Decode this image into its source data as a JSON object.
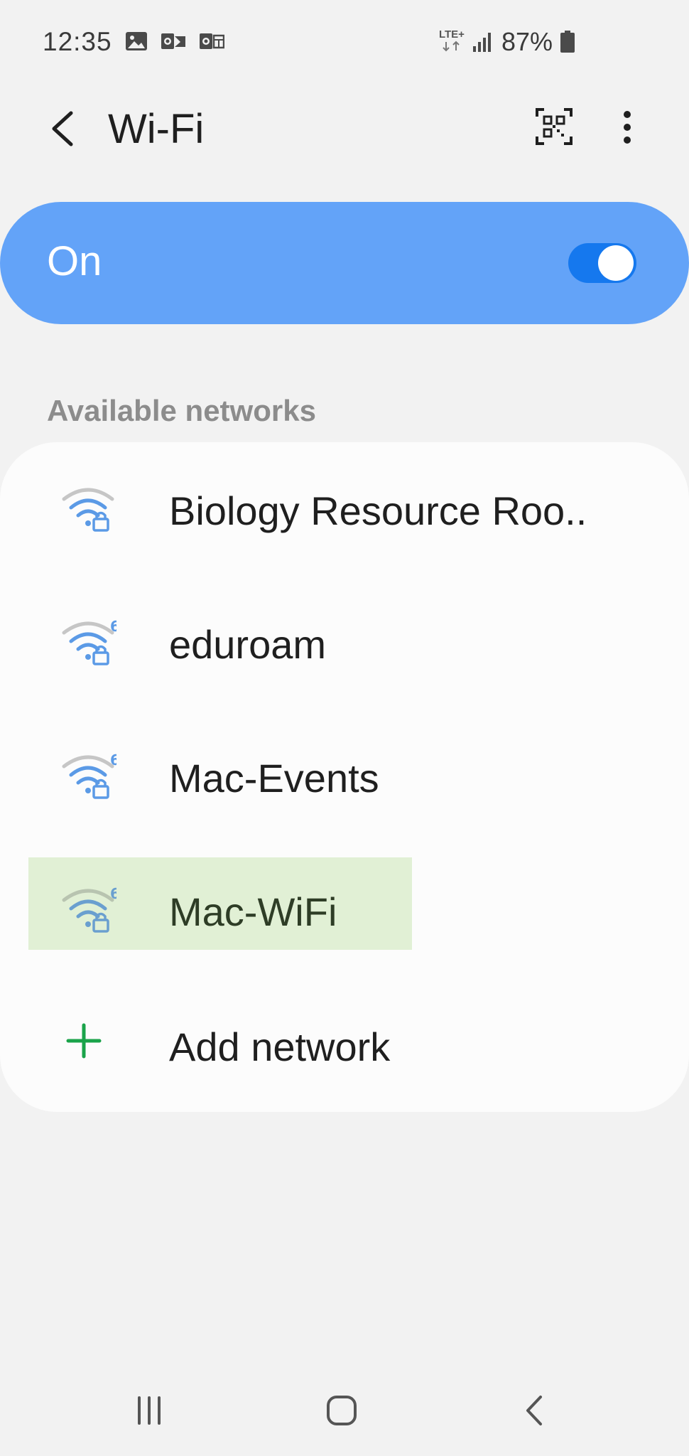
{
  "status_bar": {
    "time": "12:35",
    "network_type": "LTE+",
    "battery_percent": "87%",
    "battery_level": 0.87,
    "signal_bars": 4
  },
  "app_bar": {
    "title": "Wi-Fi"
  },
  "master_toggle": {
    "label": "On",
    "state": true,
    "accent_color": "#63a3f8",
    "switch_color": "#1578ee"
  },
  "available": {
    "header": "Available networks",
    "networks": [
      {
        "name": "Biology Resource Roo..",
        "secured": true,
        "wifi6": false
      },
      {
        "name": "eduroam",
        "secured": true,
        "wifi6": true
      },
      {
        "name": "Mac-Events",
        "secured": true,
        "wifi6": true
      },
      {
        "name": "Mac-WiFi",
        "secured": true,
        "wifi6": true,
        "highlighted": true
      }
    ],
    "add_network_label": "Add network",
    "highlight_color": "#e1f0d5"
  },
  "icons": {
    "back": "back-arrow-icon",
    "qr": "qr-code-scan-icon",
    "more": "more-vertical-icon",
    "wifi": "wifi-lock-icon",
    "plus": "plus-icon"
  }
}
